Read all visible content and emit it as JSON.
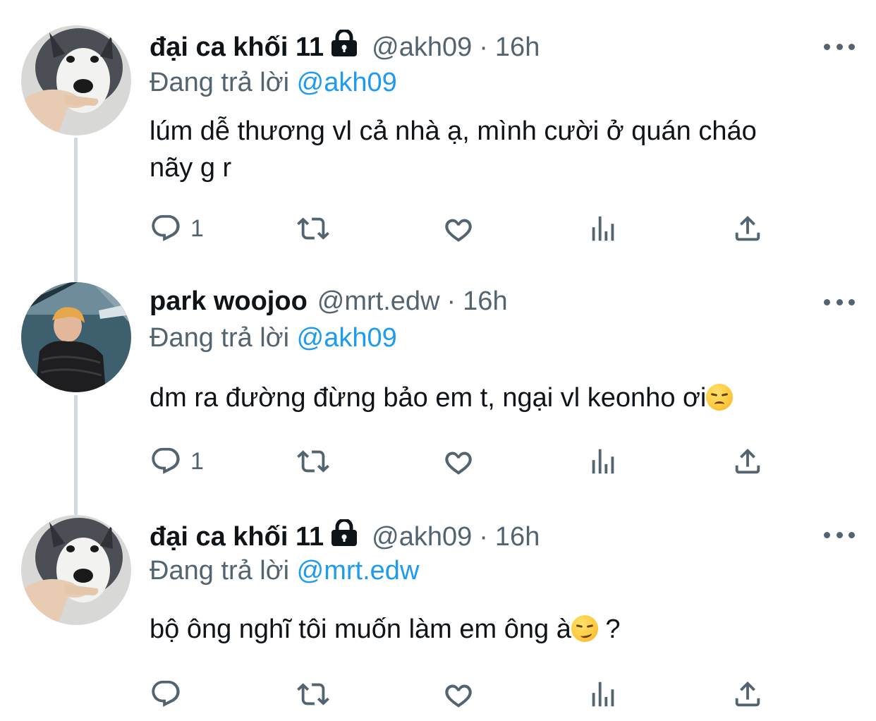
{
  "tweets": [
    {
      "display_name": "đại ca khối 11",
      "locked": true,
      "handle": "@akh09",
      "separator": "·",
      "time": "16h",
      "replying_prefix": "Đang trả lời",
      "replying_to": "@akh09",
      "text_lines": [
        "lúm dễ thương vl cả nhà ạ, mình cười ở quán cháo",
        "nãy g r"
      ],
      "reply_count": "1",
      "avatar": "husky-pointing-avatar"
    },
    {
      "display_name": "park woojoo",
      "locked": false,
      "handle": "@mrt.edw",
      "separator": "·",
      "time": "16h",
      "replying_prefix": "Đang trả lời",
      "replying_to": "@akh09",
      "text": "dm ra đường đừng bảo em t, ngại vl keonho ơi",
      "emoji": "pensive-face",
      "reply_count": "1",
      "avatar": "person-selfie-avatar"
    },
    {
      "display_name": "đại ca khối 11",
      "locked": true,
      "handle": "@akh09",
      "separator": "·",
      "time": "16h",
      "replying_prefix": "Đang trả lời",
      "replying_to": "@mrt.edw",
      "text_before_emoji": "bộ ông nghĩ tôi muốn làm em ông à",
      "emoji": "smirking-face",
      "text_after_emoji": " ?",
      "reply_count": "",
      "avatar": "husky-pointing-avatar"
    }
  ],
  "icons": {
    "reply": "reply-icon",
    "retweet": "retweet-icon",
    "like": "heart-icon",
    "analytics": "analytics-icon",
    "share": "share-icon",
    "more": "more-icon",
    "lock": "lock-icon"
  },
  "colors": {
    "text": "#0f1419",
    "secondary": "#536471",
    "link": "#1d9bf0",
    "thread_line": "#cfd9de"
  }
}
